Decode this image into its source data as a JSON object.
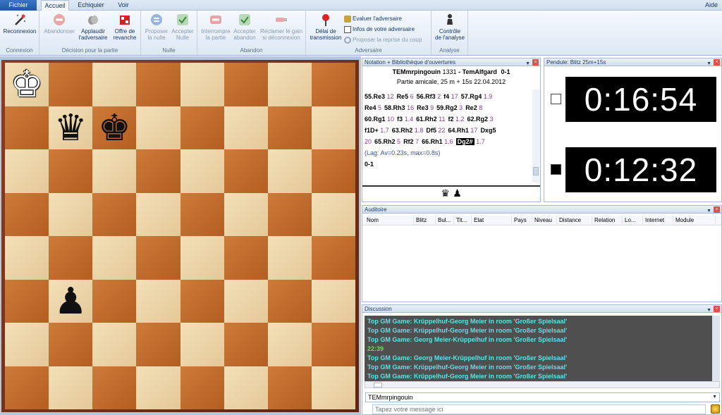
{
  "menu": {
    "file": "Fichier",
    "tabs": [
      "Accueil",
      "Echiquier",
      "Voir"
    ],
    "active_tab": "Accueil",
    "help": "Aide"
  },
  "ribbon": {
    "groups": {
      "connexion": "Connexion",
      "decision": "Décision pour la partie",
      "nulle": "Nulle",
      "abandon": "Abandon",
      "adversaire": "Adversaire",
      "analyse": "Analyse"
    },
    "buttons": {
      "reconnexion": [
        "Reconnexion"
      ],
      "abandonner": [
        "Abandonner"
      ],
      "applaudir": [
        "Applaudir",
        "l'adversaire"
      ],
      "revanche": [
        "Offre de",
        "revanche"
      ],
      "proposer_nulle": [
        "Proposer",
        "la nulle"
      ],
      "accepter_nulle": [
        "Accepter",
        "Nulle"
      ],
      "interrompre": [
        "Interrompre",
        "la partie"
      ],
      "accepter_abandon": [
        "Accepter",
        "abandon"
      ],
      "reclamer": [
        "Réclamer le gain",
        "si déconnexion"
      ],
      "delai": [
        "Délai de",
        "transmission"
      ],
      "controle": [
        "Contrôle",
        "de l'analyse"
      ]
    },
    "small": {
      "evaluer": "Evaluer l'adversaire",
      "infos": "Infos de votre adversaire",
      "reprise": "Proposer la reprise du coup"
    }
  },
  "board": {
    "pieces": [
      {
        "name": "white-king",
        "glyph": "♚",
        "color": "white",
        "file": 0,
        "rank": 7
      },
      {
        "name": "black-queen",
        "glyph": "♛",
        "color": "black",
        "file": 1,
        "rank": 6
      },
      {
        "name": "black-king",
        "glyph": "♚",
        "color": "black",
        "file": 2,
        "rank": 6
      },
      {
        "name": "black-pawn",
        "glyph": "♟",
        "color": "black",
        "file": 1,
        "rank": 2
      }
    ]
  },
  "notation": {
    "title": "Notation + Bibliothèque d'ouvertures",
    "white_player": "TEMmrpingouin",
    "white_rating": "1331",
    "separator": "-",
    "black_player": "TemAlfgard",
    "result": "0-1",
    "game_info": "Partie amicale, 25 m + 15s 22.04.2012",
    "moves": [
      [
        [
          "55.Re3",
          "12"
        ],
        [
          "Re5",
          "6"
        ],
        [
          "56.Rf3",
          "2"
        ],
        [
          "f4",
          "17"
        ],
        [
          "57.Rg4",
          "1.9"
        ]
      ],
      [
        [
          "Re4",
          "5"
        ],
        [
          "58.Rh3",
          "16"
        ],
        [
          "Re3",
          "9"
        ],
        [
          "59.Rg2",
          "3"
        ],
        [
          "Re2",
          "8"
        ]
      ],
      [
        [
          "60.Rg1",
          "10"
        ],
        [
          "f3",
          "1.4"
        ],
        [
          "61.Rh2",
          "11"
        ],
        [
          "f2",
          "1.2"
        ],
        [
          "62.Rg2",
          "3"
        ]
      ],
      [
        [
          "f1D+",
          "1.7"
        ],
        [
          "63.Rh2",
          "1.8"
        ],
        [
          "Df5",
          "22"
        ],
        [
          "64.Rh1",
          "17"
        ],
        [
          "Dxg5",
          ""
        ]
      ]
    ],
    "last_line_pre": "20",
    "last_line": [
      [
        "65.Rh2",
        "5"
      ],
      [
        "Rf2",
        "7"
      ],
      [
        "66.Rh1",
        "1.6"
      ]
    ],
    "current_move": "Dg2#",
    "current_time": "1.7",
    "lag": "(Lag: Av=0.23s, max=0.8s)",
    "final_result": "0-1",
    "material": "♛ ♟"
  },
  "clock": {
    "title": "Pendule: Blitz 25m+15s",
    "white_time": "0:16:54",
    "black_time": "0:12:32"
  },
  "audience": {
    "title": "Auditoire",
    "columns": [
      "Nom",
      "Blitz",
      "Bul...",
      "Tit...",
      "Etat",
      "Pays",
      "Niveau",
      "Distance",
      "Relation",
      "Lo...",
      "Internet",
      "Module"
    ]
  },
  "chat": {
    "title": "Discussion",
    "lines": [
      {
        "text": "Top GM Game: Krüppelhuf-Georg Meier in room 'Großer Spielsaal'",
        "type": "msg"
      },
      {
        "text": "Top GM Game: Krüppelhuf-Georg Meier in room 'Großer Spielsaal'",
        "type": "msg"
      },
      {
        "text": "Top GM Game: Georg Meier-Krüppelhuf in room 'Großer Spielsaal'",
        "type": "msg"
      },
      {
        "text": "22:39",
        "type": "time"
      },
      {
        "text": "Top GM Game: Georg Meier-Krüppelhuf in room 'Großer Spielsaal'",
        "type": "msg"
      },
      {
        "text": "Top GM Game: Krüppelhuf-Georg Meier in room 'Großer Spielsaal'",
        "type": "msg"
      },
      {
        "text": "Top GM Game: Krüppelhuf-Georg Meier in room 'Großer Spielsaal'",
        "type": "msg"
      }
    ],
    "room": "TEMmrpingouin",
    "placeholder": "Tapez votre message ici"
  }
}
